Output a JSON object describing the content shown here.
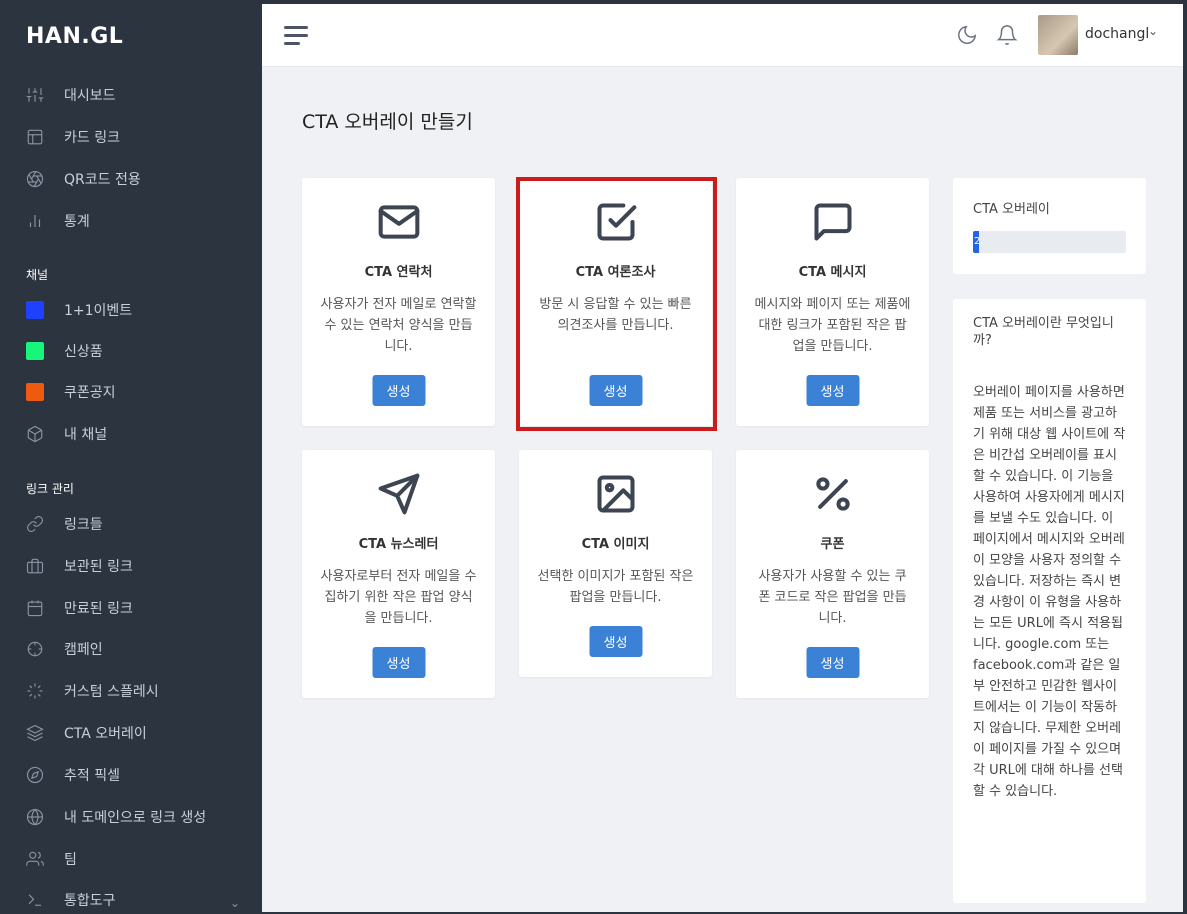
{
  "sidebar": {
    "logo": "HAN.GL",
    "items": [
      {
        "label": "대시보드",
        "icon": "sliders-icon"
      },
      {
        "label": "카드 링크",
        "icon": "layout-icon"
      },
      {
        "label": "QR코드 전용",
        "icon": "aperture-icon"
      },
      {
        "label": "통계",
        "icon": "bar-chart-icon"
      }
    ],
    "channels_label": "채널",
    "channels": [
      {
        "label": "1+1이벤트",
        "color": "#1e40ff"
      },
      {
        "label": "신상품",
        "color": "#17f57a"
      },
      {
        "label": "쿠폰공지",
        "color": "#ef5a11"
      },
      {
        "label": "내 채널",
        "icon": "box-icon"
      }
    ],
    "links_label": "링크 관리",
    "links": [
      {
        "label": "링크들",
        "icon": "link-icon"
      },
      {
        "label": "보관된 링크",
        "icon": "archive-icon"
      },
      {
        "label": "만료된 링크",
        "icon": "calendar-icon"
      },
      {
        "label": "캠페인",
        "icon": "crosshair-icon"
      },
      {
        "label": "커스텀 스플레시",
        "icon": "loader-icon"
      },
      {
        "label": "CTA 오버레이",
        "icon": "layers-icon"
      },
      {
        "label": "추적 픽셀",
        "icon": "compass-icon"
      },
      {
        "label": "내 도메인으로 링크 생성",
        "icon": "globe-icon"
      },
      {
        "label": "팀",
        "icon": "users-icon"
      },
      {
        "label": "통합도구",
        "icon": "terminal-icon"
      }
    ]
  },
  "topbar": {
    "username": "dochangl"
  },
  "main": {
    "title": "CTA 오버레이 만들기",
    "button_label": "생성",
    "cards": [
      {
        "title": "CTA 연락처",
        "desc": "사용자가 전자 메일로 연락할 수 있는 연락처 양식을 만듭니다.",
        "icon": "mail-icon"
      },
      {
        "title": "CTA 여론조사",
        "desc": "방문 시 응답할 수 있는 빠른 의견조사를 만듭니다.",
        "icon": "check-square-icon"
      },
      {
        "title": "CTA 메시지",
        "desc": "메시지와 페이지 또는 제품에 대한 링크가 포함된 작은 팝업을 만듭니다.",
        "icon": "message-square-icon"
      },
      {
        "title": "CTA 뉴스레터",
        "desc": "사용자로부터 전자 메일을 수집하기 위한 작은 팝업 양식을 만듭니다.",
        "icon": "send-icon"
      },
      {
        "title": "CTA 이미지",
        "desc": "선택한 이미지가 포함된 작은 팝업을 만듭니다.",
        "icon": "image-icon"
      },
      {
        "title": "쿠폰",
        "desc": "사용자가 사용할 수 있는 쿠폰 코드로 작은 팝업을 만듭니다.",
        "icon": "percent-icon"
      }
    ]
  },
  "usage": {
    "label": "CTA 오버레이",
    "count": "2",
    "fraction": 0.04
  },
  "info": {
    "title": "CTA 오버레이란 무엇입니까?",
    "body": "오버레이 페이지를 사용하면 제품 또는 서비스를 광고하기 위해 대상 웹 사이트에 작은 비간섭 오버레이를 표시할 수 있습니다. 이 기능을 사용하여 사용자에게 메시지를 보낼 수도 있습니다. 이 페이지에서 메시지와 오버레이 모양을 사용자 정의할 수 있습니다. 저장하는 즉시 변경 사항이 이 유형을 사용하는 모든 URL에 즉시 적용됩니다. google.com 또는 facebook.com과 같은 일부 안전하고 민감한 웹사이트에서는 이 기능이 작동하지 않습니다. 무제한 오버레이 페이지를 가질 수 있으며 각 URL에 대해 하나를 선택할 수 있습니다."
  }
}
